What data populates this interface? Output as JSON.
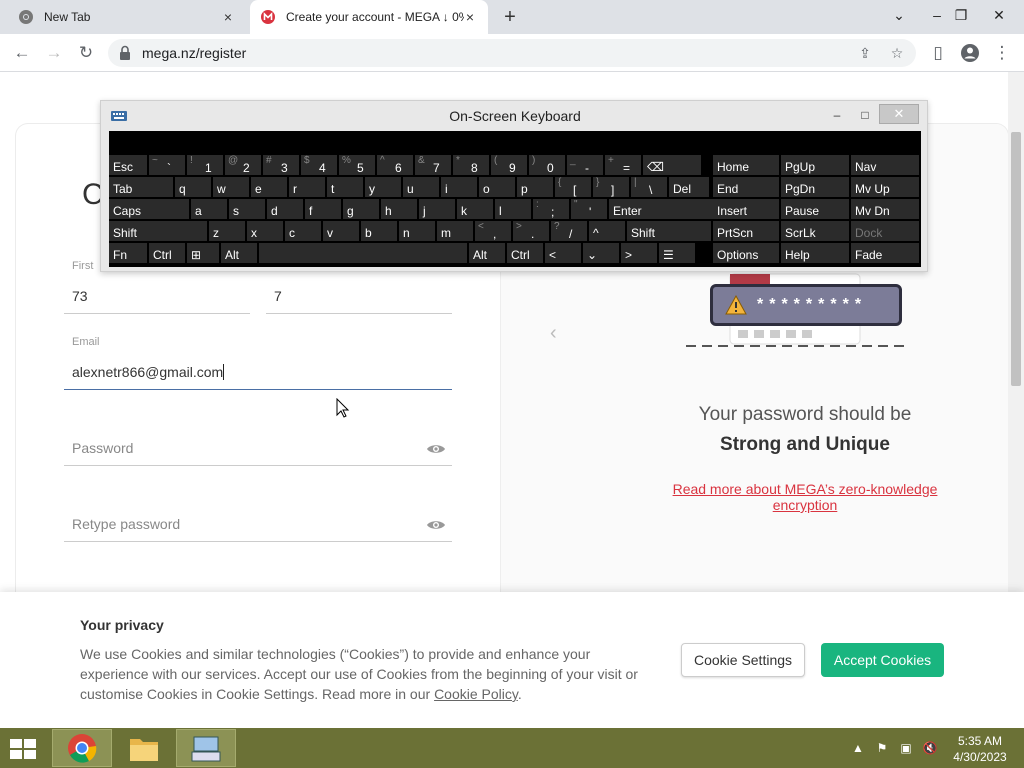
{
  "browser": {
    "tabs": [
      {
        "title": "New Tab",
        "close": "×"
      },
      {
        "title": "Create your account - MEGA ↓ 0%",
        "close": "×"
      }
    ],
    "new_tab": "+",
    "window_controls": {
      "dropdown": "⌄",
      "minimize": "–",
      "restore": "❐",
      "close": "✕"
    },
    "url": "mega.nz/register"
  },
  "form": {
    "heading_fragment": "C",
    "first_name_label": "First",
    "first_name_value": "73",
    "last_name_value": "7",
    "email_label": "Email",
    "email_value": "alexnetr866@gmail.com",
    "password_placeholder": "Password",
    "retype_password_placeholder": "Retype password"
  },
  "info_panel": {
    "line1": "Your password should be",
    "line2": "Strong and Unique",
    "link": "Read more about MEGA’s zero-knowledge encryption",
    "masked_password": "*********"
  },
  "cookie_banner": {
    "title": "Your privacy",
    "text": "We use Cookies and similar technologies (“Cookies”) to provide and enhance your experience with our services. Accept our use of Cookies from the beginning of your visit or customise Cookies in Cookie Settings. Read more in our ",
    "policy_link": "Cookie Policy",
    "period": ".",
    "settings_button": "Cookie Settings",
    "accept_button": "Accept Cookies"
  },
  "osk": {
    "title": "On-Screen Keyboard",
    "minimize": "–",
    "maximize": "□",
    "close": "✕",
    "rows": [
      [
        [
          "Esc",
          ""
        ],
        [
          "`",
          "~"
        ],
        [
          "1",
          "!"
        ],
        [
          "2",
          "@"
        ],
        [
          "3",
          "#"
        ],
        [
          "4",
          "$"
        ],
        [
          "5",
          "%"
        ],
        [
          "6",
          "^"
        ],
        [
          "7",
          "&"
        ],
        [
          "8",
          "*"
        ],
        [
          "9",
          "("
        ],
        [
          "0",
          ")"
        ],
        [
          "-",
          "_"
        ],
        [
          "=",
          "+"
        ],
        [
          "⌫",
          ""
        ]
      ],
      [
        [
          "Tab",
          ""
        ],
        [
          "q",
          ""
        ],
        [
          "w",
          ""
        ],
        [
          "e",
          ""
        ],
        [
          "r",
          ""
        ],
        [
          "t",
          ""
        ],
        [
          "y",
          ""
        ],
        [
          "u",
          ""
        ],
        [
          "i",
          ""
        ],
        [
          "o",
          ""
        ],
        [
          "p",
          ""
        ],
        [
          "[",
          "{"
        ],
        [
          "]",
          "}"
        ],
        [
          "\\",
          "|"
        ],
        [
          "Del",
          ""
        ]
      ],
      [
        [
          "Caps",
          ""
        ],
        [
          "a",
          ""
        ],
        [
          "s",
          ""
        ],
        [
          "d",
          ""
        ],
        [
          "f",
          ""
        ],
        [
          "g",
          ""
        ],
        [
          "h",
          ""
        ],
        [
          "j",
          ""
        ],
        [
          "k",
          ""
        ],
        [
          "l",
          ""
        ],
        [
          ";",
          ":"
        ],
        [
          "'",
          "\""
        ],
        [
          "Enter",
          ""
        ]
      ],
      [
        [
          "Shift",
          ""
        ],
        [
          "z",
          ""
        ],
        [
          "x",
          ""
        ],
        [
          "c",
          ""
        ],
        [
          "v",
          ""
        ],
        [
          "b",
          ""
        ],
        [
          "n",
          ""
        ],
        [
          "m",
          ""
        ],
        [
          ",",
          "<"
        ],
        [
          ".",
          ">"
        ],
        [
          "/",
          "?"
        ],
        [
          "^",
          ""
        ],
        [
          "Shift",
          ""
        ]
      ],
      [
        [
          "Fn",
          ""
        ],
        [
          "Ctrl",
          ""
        ],
        [
          "⊞",
          ""
        ],
        [
          "Alt",
          ""
        ],
        [
          "",
          ""
        ],
        [
          "Alt",
          ""
        ],
        [
          "Ctrl",
          ""
        ],
        [
          "<",
          ""
        ],
        [
          "⌄",
          ""
        ],
        [
          ">",
          ""
        ],
        [
          "☰",
          ""
        ]
      ]
    ],
    "nav_keys": [
      [
        "Home",
        "PgUp",
        "Nav"
      ],
      [
        "End",
        "PgDn",
        "Mv Up"
      ],
      [
        "Insert",
        "Pause",
        "Mv Dn"
      ],
      [
        "PrtScn",
        "ScrLk",
        "Dock"
      ],
      [
        "Options",
        "Help",
        "Fade"
      ]
    ]
  },
  "taskbar": {
    "time": "5:35 AM",
    "date": "4/30/2023"
  },
  "colors": {
    "mega_red": "#d9333f",
    "accept_green": "#19b57f",
    "taskbar": "#6b7136"
  }
}
